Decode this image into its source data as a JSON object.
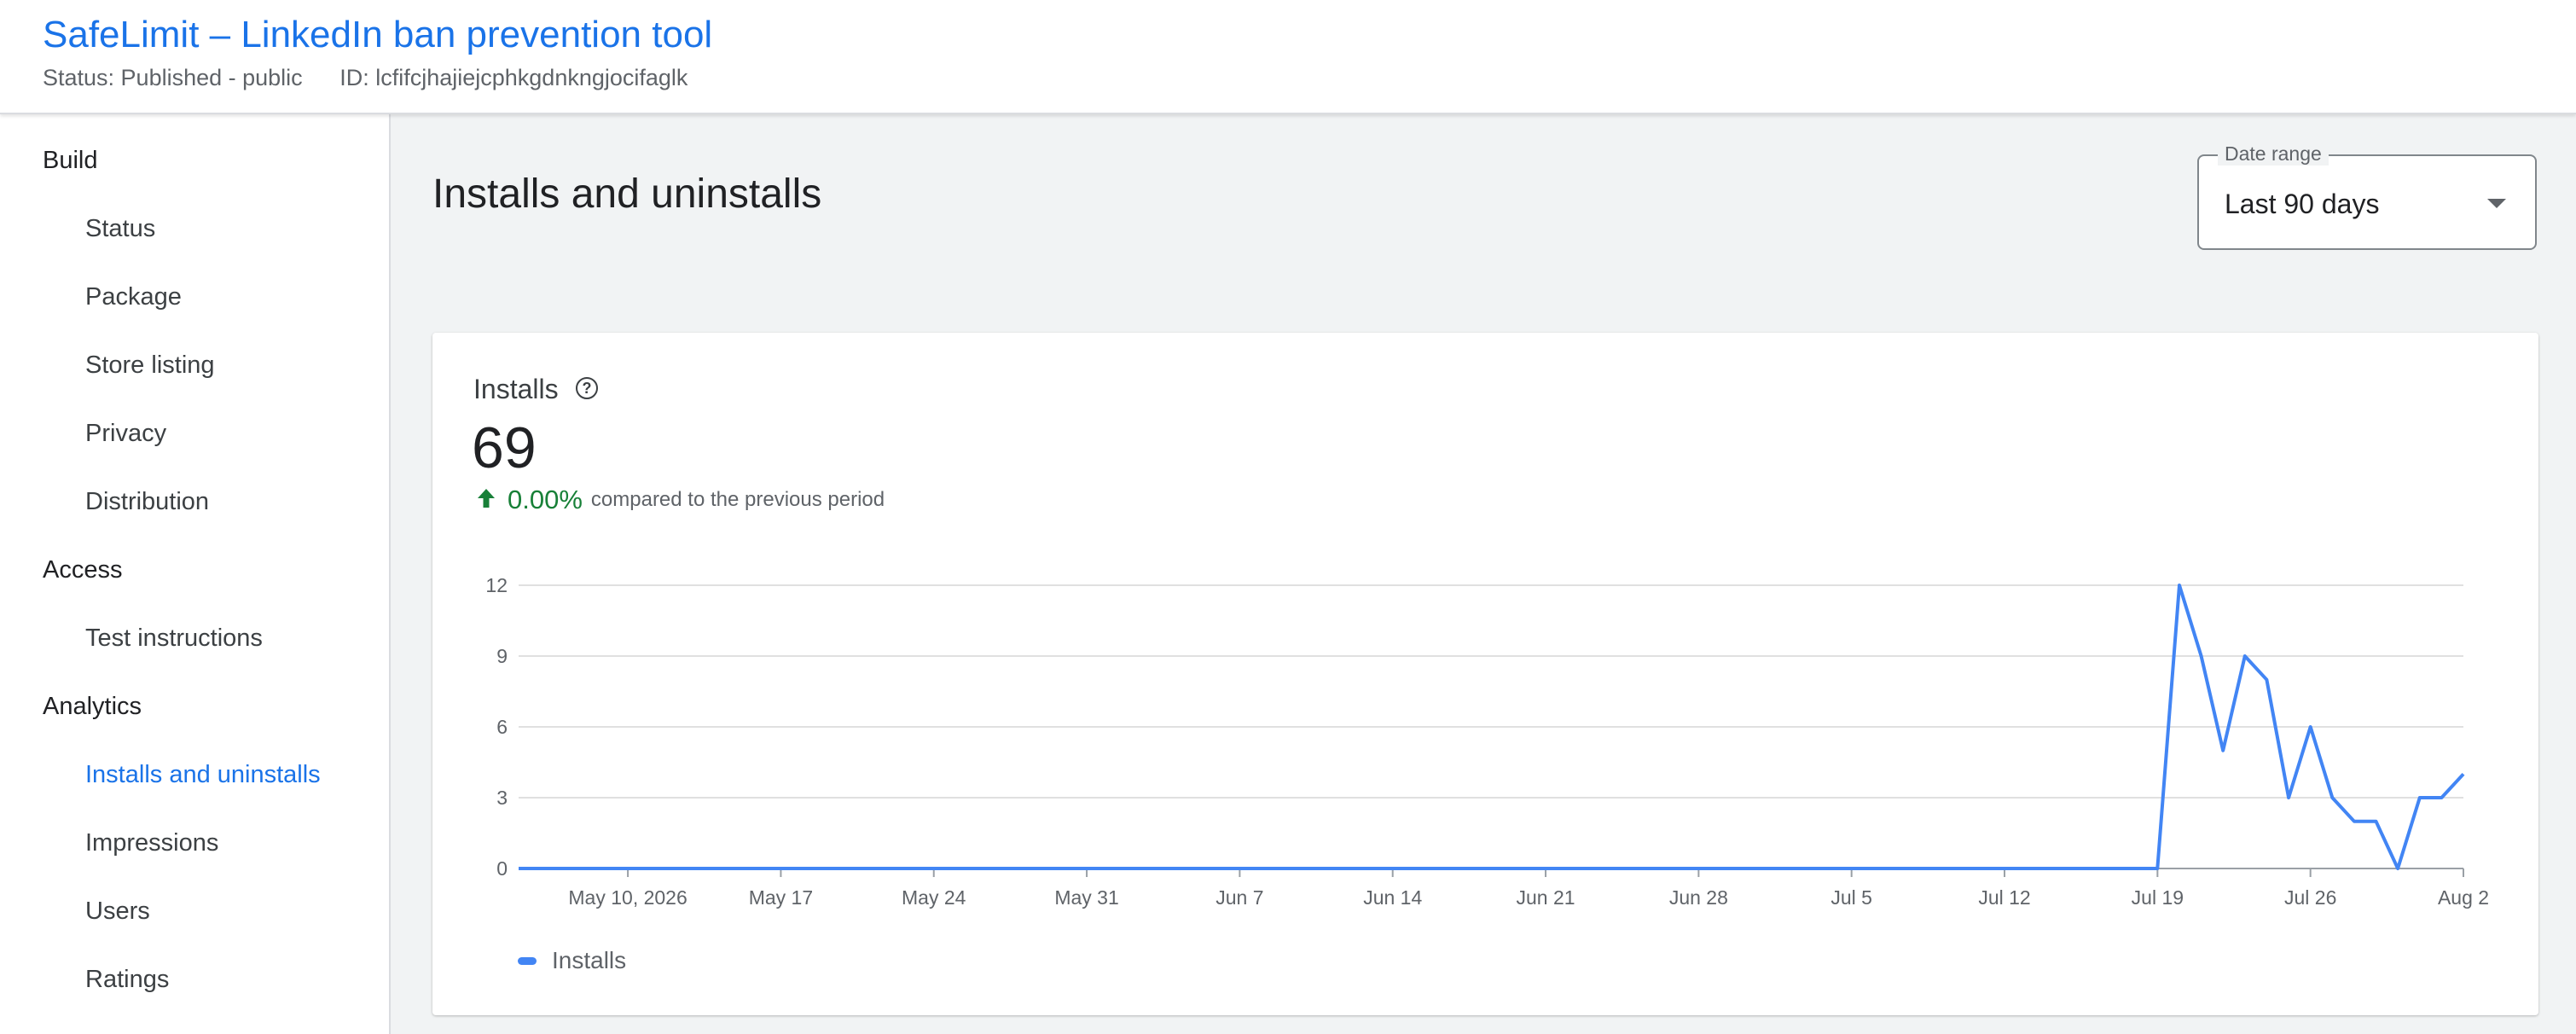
{
  "header": {
    "title": "SafeLimit – LinkedIn ban prevention tool",
    "status": "Status: Published - public",
    "id": "ID: lcfifcjhajiejcphkgdnkngjocifaglk"
  },
  "sidebar": {
    "sections": [
      {
        "label": "Build",
        "items": [
          "Status",
          "Package",
          "Store listing",
          "Privacy",
          "Distribution"
        ]
      },
      {
        "label": "Access",
        "items": [
          "Test instructions"
        ]
      },
      {
        "label": "Analytics",
        "items": [
          "Installs and uninstalls",
          "Impressions",
          "Users",
          "Ratings"
        ]
      }
    ],
    "active_item": "Installs and uninstalls"
  },
  "main": {
    "title": "Installs and uninstalls",
    "date_range": {
      "label": "Date range",
      "value": "Last 90 days",
      "icon": "chevron-down-icon"
    },
    "card": {
      "title": "Installs",
      "help_icon": "help-icon",
      "metric_value": "69",
      "delta_percent": "0.00%",
      "delta_text": "compared to the previous period",
      "delta_icon": "arrow-up-icon"
    }
  },
  "colors": {
    "accent": "#1a73e8",
    "series": "#4285f4",
    "positive": "#188038"
  },
  "chart_data": {
    "type": "line",
    "title": "",
    "xlabel": "",
    "ylabel": "",
    "ylim": [
      0,
      12
    ],
    "y_ticks": [
      0,
      3,
      6,
      9,
      12
    ],
    "x_tick_labels": [
      "May 10, 2026",
      "May 17",
      "May 24",
      "May 31",
      "Jun 7",
      "Jun 14",
      "Jun 21",
      "Jun 28",
      "Jul 5",
      "Jul 12",
      "Jul 19",
      "Jul 26",
      "Aug 2"
    ],
    "x_range": [
      "2026-05-05",
      "2026-08-02"
    ],
    "grid": "horizontal",
    "legend": "bottom-left",
    "series": [
      {
        "name": "Installs",
        "color": "#4285f4",
        "points": [
          [
            "2026-05-05",
            0
          ],
          [
            "2026-07-19",
            0
          ],
          [
            "2026-07-20",
            12
          ],
          [
            "2026-07-21",
            9
          ],
          [
            "2026-07-22",
            5
          ],
          [
            "2026-07-23",
            9
          ],
          [
            "2026-07-24",
            8
          ],
          [
            "2026-07-25",
            3
          ],
          [
            "2026-07-26",
            6
          ],
          [
            "2026-07-27",
            3
          ],
          [
            "2026-07-28",
            2
          ],
          [
            "2026-07-29",
            2
          ],
          [
            "2026-07-30",
            0
          ],
          [
            "2026-07-31",
            3
          ],
          [
            "2026-08-01",
            3
          ],
          [
            "2026-08-02",
            4
          ]
        ]
      }
    ]
  }
}
